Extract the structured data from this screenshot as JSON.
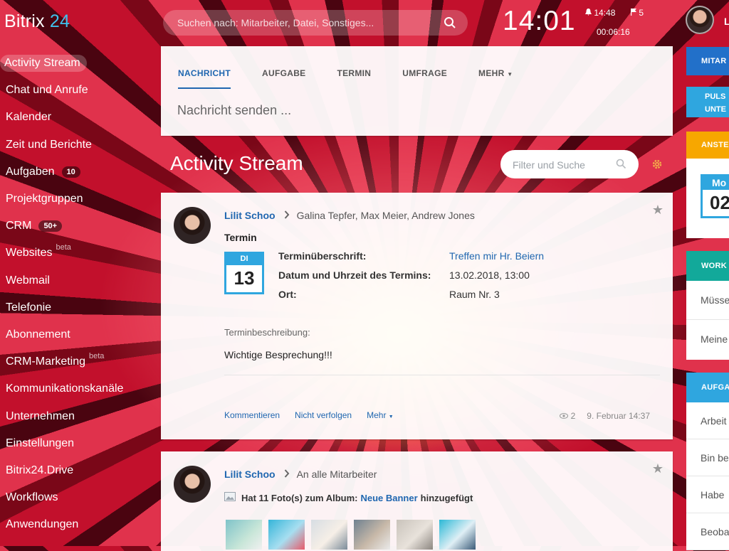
{
  "app": {
    "logo_name": "Bitrix",
    "logo_num": "24"
  },
  "sidebar": {
    "items": [
      {
        "label": "Activity Stream",
        "active": true
      },
      {
        "label": "Chat und Anrufe"
      },
      {
        "label": "Kalender"
      },
      {
        "label": "Zeit und Berichte"
      },
      {
        "label": "Aufgaben",
        "count": "10"
      },
      {
        "label": "Projektgruppen"
      },
      {
        "label": "CRM",
        "count": "50+"
      },
      {
        "label": "Websites",
        "beta": "beta"
      },
      {
        "label": "Webmail"
      },
      {
        "label": "Telefonie"
      },
      {
        "label": "Abonnement"
      },
      {
        "label": "CRM-Marketing",
        "beta": "beta"
      },
      {
        "label": "Kommunikationskanäle"
      },
      {
        "label": "Unternehmen"
      },
      {
        "label": "Einstellungen"
      },
      {
        "label": "Bitrix24.Drive"
      },
      {
        "label": "Workflows"
      },
      {
        "label": "Anwendungen"
      }
    ]
  },
  "header": {
    "search_placeholder": "Suchen nach: Mitarbeiter, Datei, Sonstiges...",
    "clock": "14:01",
    "alarm_time": "14:48",
    "flag_count": "5",
    "timer": "00:06:16",
    "user_initial": "L"
  },
  "composer": {
    "tabs": [
      "NACHRICHT",
      "AUFGABE",
      "TERMIN",
      "UMFRAGE",
      "MEHR"
    ],
    "placeholder": "Nachricht senden ..."
  },
  "stream": {
    "title": "Activity Stream",
    "filter_placeholder": "Filter und Suche"
  },
  "post1": {
    "author": "Lilit Schoo",
    "recipients": "Galina Tepfer, Max Meier, Andrew Jones",
    "type": "Termin",
    "cal_day": "DI",
    "cal_date": "13",
    "fields": [
      {
        "label": "Terminüberschrift:",
        "value": "Treffen mir Hr. Beiern",
        "link": true
      },
      {
        "label": "Datum und Uhrzeit des Termins:",
        "value": "13.02.2018, 13:00"
      },
      {
        "label": "Ort:",
        "value": "Raum Nr. 3"
      }
    ],
    "desc_label": "Terminbeschreibung:",
    "desc": "Wichtige Besprechung!!!",
    "actions": [
      "Kommentieren",
      "Nicht verfolgen",
      "Mehr"
    ],
    "views": "2",
    "date": "9. Februar 14:37"
  },
  "post2": {
    "author": "Lilit Schoo",
    "recipients": "An alle Mitarbeiter",
    "photo_text": "Hat 11 Foto(s) zum Album:",
    "album": "Neue Banner",
    "added": "hinzugefügt"
  },
  "right": {
    "box1": "MITAR",
    "box2a": "PULS",
    "box2b": "UNTE",
    "box3": "ANSTE",
    "cal_day": "Mo",
    "cal_date": "02",
    "box4": "WORK",
    "box4_rows": [
      "Müsse",
      "Meine"
    ],
    "box5": "AUFGA",
    "box5_rows": [
      "Arbeit",
      "Bin be",
      "Habe",
      "Beoba"
    ]
  },
  "colors": {
    "accent": "#2067b0",
    "light_blue": "#2fa6df",
    "green": "#12a99a",
    "orange": "#f7a700",
    "dark_blue": "#2270c9"
  }
}
